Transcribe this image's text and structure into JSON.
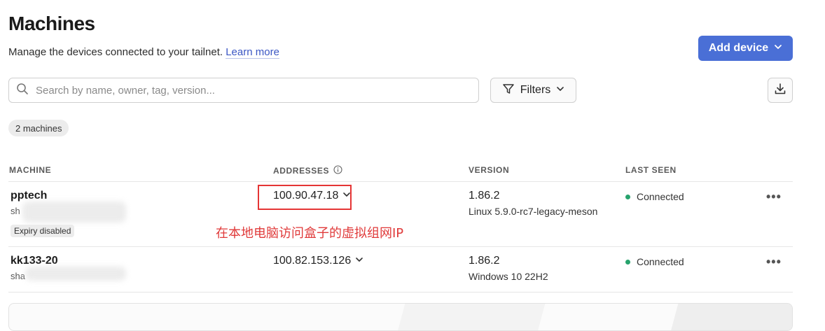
{
  "header": {
    "title": "Machines",
    "subtitle": "Manage the devices connected to your tailnet.",
    "learn_more": "Learn more",
    "add_device": "Add device"
  },
  "toolbar": {
    "search_placeholder": "Search by name, owner, tag, version...",
    "filters_label": "Filters"
  },
  "machine_count": "2 machines",
  "table": {
    "columns": [
      "MACHINE",
      "ADDRESSES",
      "VERSION",
      "LAST SEEN"
    ],
    "rows": [
      {
        "name": "pptech",
        "owner": "sh",
        "badge": "Expiry disabled",
        "address": "100.90.47.18",
        "version": "1.86.2",
        "os": "Linux 5.9.0-rc7-legacy-meson",
        "last_seen": "Connected",
        "more": "•••"
      },
      {
        "name": "kk133-20",
        "owner": "sha",
        "address": "100.82.153.126",
        "version": "1.86.2",
        "os": "Windows 10 22H2",
        "last_seen": "Connected",
        "more": "•••"
      }
    ]
  },
  "annotation": "在本地电脑访问盒子的虚拟组网IP",
  "colors": {
    "accent": "#4a6fd6",
    "link": "#3a56c4",
    "connected": "#27a36d",
    "annotation": "#e53535"
  },
  "icons": {
    "search": "search-icon",
    "filter": "filter-icon",
    "download": "download-icon",
    "chevron": "chevron-down-icon",
    "info": "info-icon",
    "more": "more-icon"
  }
}
